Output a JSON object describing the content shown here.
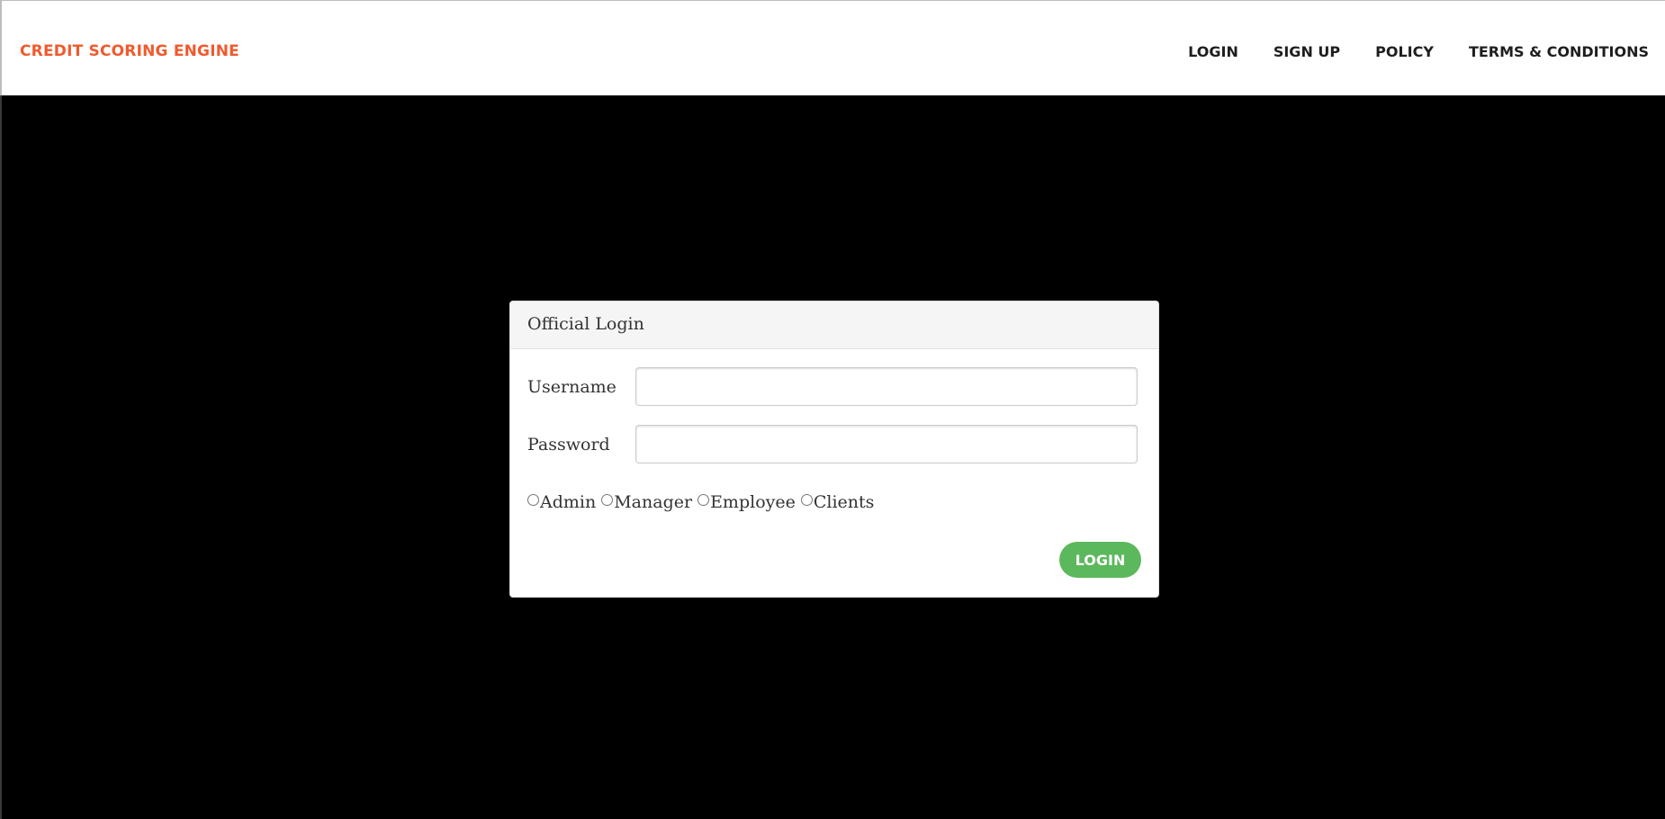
{
  "navbar": {
    "brand": "CREDIT SCORING ENGINE",
    "links": [
      {
        "label": "LOGIN"
      },
      {
        "label": "SIGN UP"
      },
      {
        "label": "POLICY"
      },
      {
        "label": "TERMS & CONDITIONS"
      }
    ]
  },
  "login_panel": {
    "title": "Official Login",
    "username": {
      "label": "Username",
      "value": "",
      "placeholder": ""
    },
    "password": {
      "label": "Password",
      "value": "",
      "placeholder": ""
    },
    "roles": [
      {
        "label": "Admin",
        "checked": false
      },
      {
        "label": "Manager",
        "checked": false
      },
      {
        "label": "Employee",
        "checked": false
      },
      {
        "label": "Clients",
        "checked": false
      }
    ],
    "submit_label": "LOGIN"
  },
  "colors": {
    "brand": "#ef5a2e",
    "page_background": "#000000",
    "navbar_background": "#ffffff",
    "button_success": "#5cb85c",
    "panel_heading": "#f5f5f5"
  }
}
